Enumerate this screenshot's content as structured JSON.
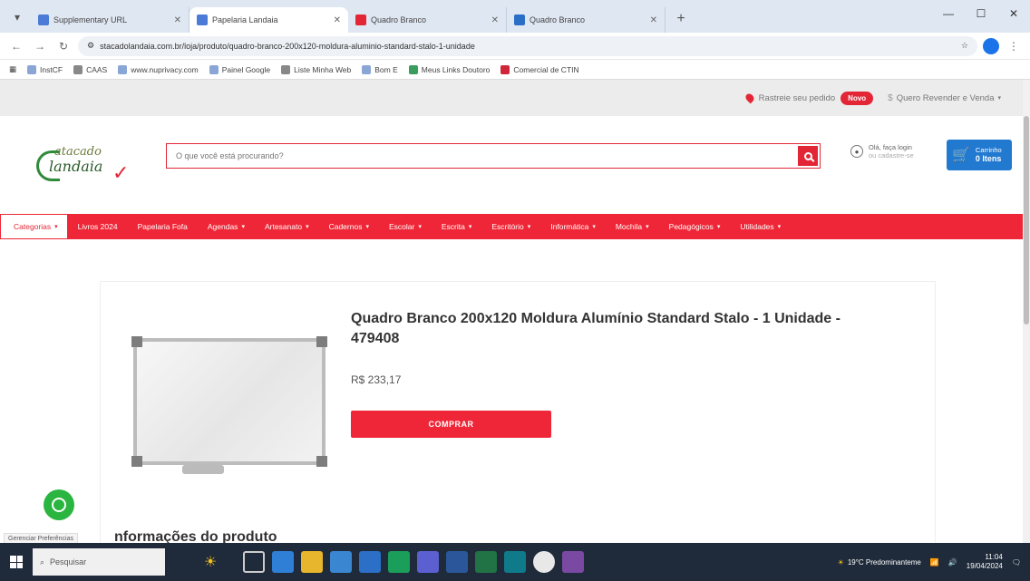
{
  "browser": {
    "tabs": [
      {
        "label": "Supplementary URL",
        "fav": ""
      },
      {
        "label": "Papelaria Landaia",
        "fav": "blue"
      },
      {
        "label": "Quadro Branco",
        "fav": "red"
      },
      {
        "label": "Quadro Branco",
        "fav": "blue2"
      }
    ],
    "url": "stacadolandaia.com.br/loja/produto/quadro-branco-200x120-moldura-aluminio-standard-stalo-1-unidade",
    "bookmarks": [
      "InstCF",
      "CAAS",
      "www.nuprivacy.com",
      "Painel Google",
      "Liste Minha Web",
      "Bom E",
      "Meus Links Doutoro",
      "Comercial de CTIN"
    ]
  },
  "topbar": {
    "track_label": "Rastreie seu pedido",
    "new_badge": "Novo",
    "wholesale_label": "Quero Revender e Venda"
  },
  "header": {
    "logo_line1": "atacado",
    "logo_line2": "landaia",
    "search_placeholder": "O que você está procurando?",
    "login_line1": "Olá, faça login",
    "login_line2": "ou cadastre-se",
    "cart_line1": "Carrinho",
    "cart_line2": "0 Itens"
  },
  "categories": [
    "Categorias",
    "Livros 2024",
    "Papelaria Fofa",
    "Agendas",
    "Artesanato",
    "Cadernos",
    "Escolar",
    "Escrita",
    "Escritório",
    "Informática",
    "Mochila",
    "Pedagógicos",
    "Utilidades"
  ],
  "product": {
    "title": "Quadro Branco 200x120 Moldura Alumínio Standard Stalo - 1 Unidade - 479408",
    "price": "R$ 233,17",
    "buy_label": "COMPRAR",
    "info_heading": "nformações do produto"
  },
  "misc": {
    "prefs_tag": "Gerenciar Preferências"
  },
  "taskbar": {
    "search_placeholder": "Pesquisar",
    "weather_text": "19°C Predominanteme",
    "time": "11:04",
    "date": "19/04/2024"
  },
  "colors": {
    "brand_red": "#ef2637",
    "cart_blue": "#2279d0",
    "whatsapp_green": "#2ab540"
  }
}
